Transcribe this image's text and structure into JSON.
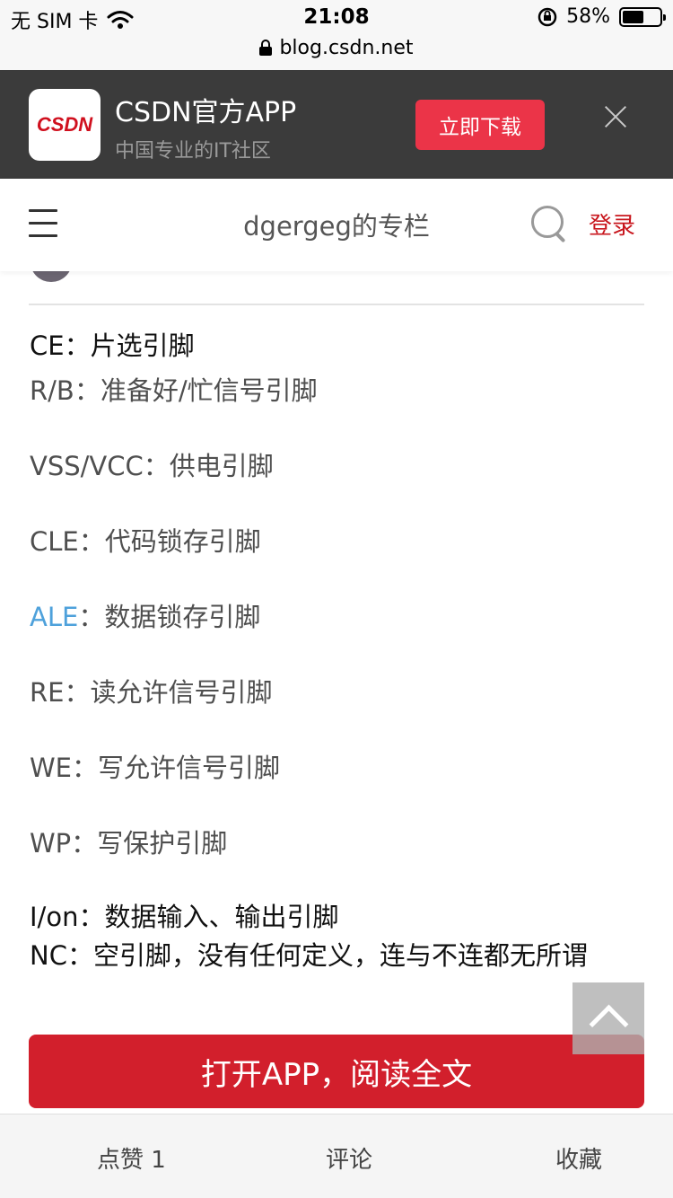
{
  "status_bar": {
    "carrier": "无 SIM 卡",
    "time": "21:08",
    "battery": "58%",
    "battery_level": 0.58
  },
  "url_bar": {
    "url": "blog.csdn.net"
  },
  "app_banner": {
    "logo_text": "CSDN",
    "title": "CSDN官方APP",
    "subtitle": "中国专业的IT社区",
    "download_label": "立即下载"
  },
  "header": {
    "title": "dgergeg的专栏",
    "login_label": "登录"
  },
  "article": {
    "lines": [
      {
        "term": "CE",
        "sep": "：",
        "desc": "片选引脚"
      },
      {
        "term": "R/B",
        "sep": "：",
        "desc": "准备好/忙信号引脚"
      },
      {
        "term": "VSS/VCC",
        "sep": "：",
        "desc": "供电引脚"
      },
      {
        "term": "CLE",
        "sep": "：",
        "desc": "代码锁存引脚"
      },
      {
        "term": "ALE",
        "sep": "：",
        "desc": "数据锁存引脚"
      },
      {
        "term": "RE",
        "sep": "：",
        "desc": "读允许信号引脚"
      },
      {
        "term": "WE",
        "sep": "：",
        "desc": "写允许信号引脚"
      },
      {
        "term": "WP",
        "sep": "：",
        "desc": "写保护引脚"
      },
      {
        "term": "I/on",
        "sep": "：",
        "desc": "数据输入、输出引脚"
      }
    ],
    "last_paragraph": "NC：空引脚，没有任何定义，连与不连都无所谓"
  },
  "open_app_label": "打开APP，阅读全文",
  "bottom_bar": {
    "like_label": "点赞 1",
    "comment_label": "评论",
    "favorite_label": "收藏"
  },
  "colors": {
    "brand_red": "#d21f2c",
    "link_blue": "#4ea1db",
    "banner_bg": "#3b3b3b"
  }
}
